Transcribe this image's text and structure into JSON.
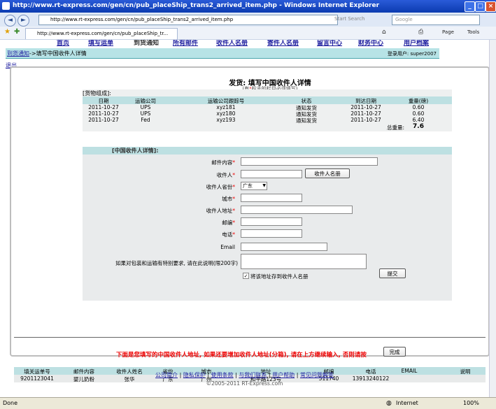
{
  "window": {
    "title": "http://www.rt-express.com/gen/cn/pub_placeShip_trans2_arrived_item.php - Windows Internet Explorer"
  },
  "browser": {
    "address": "http://www.rt-express.com/gen/cn/pub_placeShip_trans2_arrived_item.php",
    "search_placeholder": "Google",
    "tab_title": "http://www.rt-express.com/gen/cn/pub_placeShip_tr...",
    "toolbar": {
      "page": "Page",
      "tools": "Tools"
    },
    "live_search": "Start Search"
  },
  "menu": [
    "首页",
    "填写运单",
    "到货通知",
    "所有邮件",
    "收件人名册",
    "寄件人名册",
    "留言中心",
    "财务中心",
    "用户档案"
  ],
  "crumb": {
    "link": "到货通知",
    "rest": "->填写中国收件人详情",
    "user": "登录用户: super2007"
  },
  "logout": "退出",
  "page_title": "发货: 填写中国收件人详情",
  "page_subtitle_pre": "(有",
  "page_subtitle_star": "*",
  "page_subtitle_post": "标志的栏目必须填写)",
  "goods": {
    "caption": "[货物组成]:",
    "headers": [
      "日期",
      "运输公司",
      "运输公司跟踪号",
      "状态",
      "到达日期",
      "重量(磅)"
    ],
    "rows": [
      [
        "2011-10-27",
        "UPS",
        "xyz181",
        "通知发货",
        "2011-10-27",
        "0.60"
      ],
      [
        "2011-10-27",
        "UPS",
        "xyz180",
        "通知发货",
        "2011-10-27",
        "0.60"
      ],
      [
        "2011-10-27",
        "Fed",
        "xyz193",
        "通知发货",
        "2011-10-27",
        "6.40"
      ]
    ],
    "total_label": "总重量:",
    "total_value": "7.6"
  },
  "form": {
    "caption": "[中国收件人详情]:",
    "content_label": "邮件内容",
    "name_label": "收件人",
    "name_book_button": "收件人名册",
    "province_label": "收件人省份",
    "province_value": "广东",
    "city_label": "城市",
    "address_label": "收件人地址",
    "zip_label": "邮编",
    "phone_label": "电话",
    "email_label": "Email",
    "note_label": "如果对包装和运输有特别要求, 请在此说明(限200字)",
    "save_checkbox_label": "将该地址存到收件人名册",
    "submit_button": "提交"
  },
  "notice": "下面是您填写的中国收件人地址, 如果还要增加收件人地址(分箱), 请在上方继续输入, 否则请按",
  "done_button": "完成",
  "recipients": {
    "headers": [
      "填关运单号",
      "邮件内容",
      "收件人姓名",
      "省份",
      "城市",
      "地址",
      "邮编",
      "电话",
      "EMAIL",
      "说明"
    ],
    "rows": [
      [
        "9201123041",
        "婴儿奶粉",
        "张华",
        "广东",
        "广州",
        "和平路123号",
        "511740",
        "13913240122",
        "",
        ""
      ]
    ]
  },
  "footer": {
    "links": [
      "公司简介",
      "隐私保护",
      "使用条款",
      "与我们联系",
      "用户帮助",
      "常见问题解答"
    ],
    "copyright": "©2005-2011 RT-Express.com"
  },
  "status": {
    "left": "Done",
    "zone": "Internet",
    "zoom": "100%"
  }
}
